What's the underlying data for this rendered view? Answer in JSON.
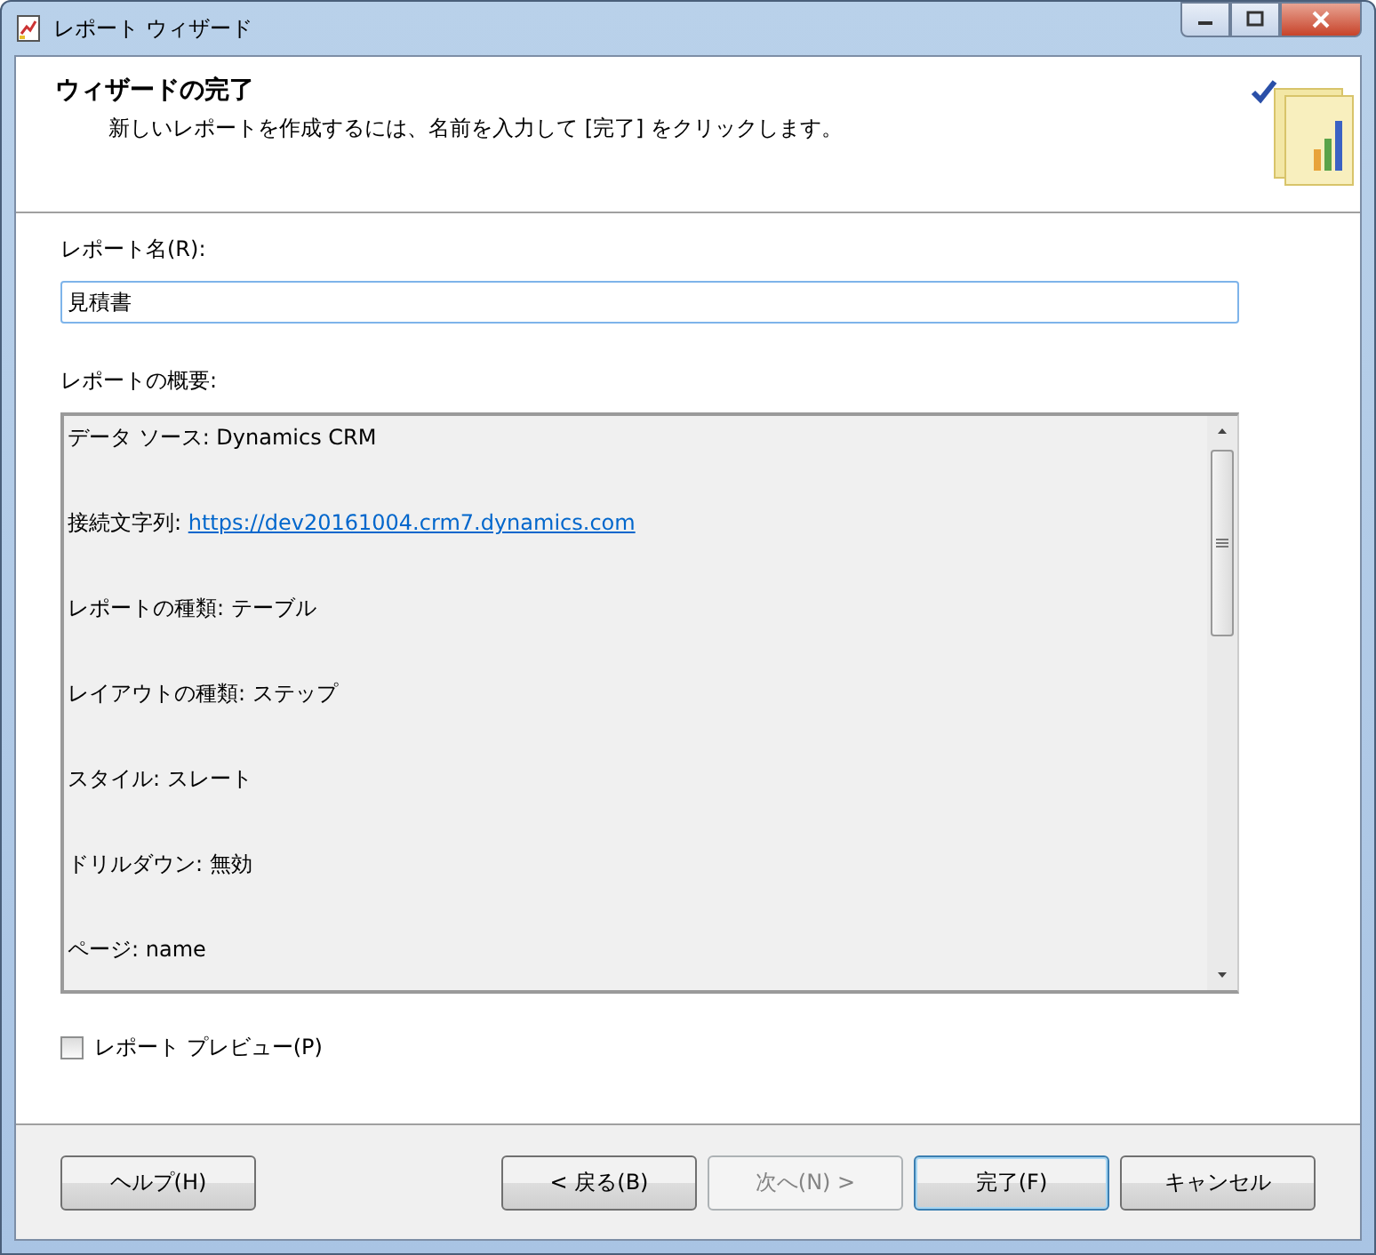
{
  "window": {
    "title": "レポート ウィザード"
  },
  "header": {
    "title": "ウィザードの完了",
    "subtitle": "新しいレポートを作成するには、名前を入力して [完了] をクリックします。"
  },
  "report_name": {
    "label": "レポート名(R):",
    "value": "見積書"
  },
  "summary": {
    "label": "レポートの概要:",
    "lines": [
      {
        "label": "データ ソース: ",
        "value": "Dynamics CRM",
        "kind": "text"
      },
      {
        "label": "接続文字列: ",
        "value": "https://dev20161004.crm7.dynamics.com",
        "kind": "link"
      },
      {
        "label": "レポートの種類: ",
        "value": "テーブル",
        "kind": "text"
      },
      {
        "label": "レイアウトの種類: ",
        "value": "ステップ",
        "kind": "text"
      },
      {
        "label": "スタイル: ",
        "value": "スレート",
        "kind": "text"
      },
      {
        "label": "ドリルダウン: ",
        "value": "無効",
        "kind": "text"
      },
      {
        "label": "ページ: ",
        "value": "name",
        "kind": "text"
      }
    ]
  },
  "preview": {
    "label": "レポート プレビュー(P)",
    "checked": false
  },
  "buttons": [
    {
      "label": "ヘルプ(H)",
      "disabled": false,
      "default": false
    },
    {
      "label": "< 戻る(B)",
      "disabled": false,
      "default": false
    },
    {
      "label": "次へ(N) >",
      "disabled": true,
      "default": false
    },
    {
      "label": "完了(F)",
      "disabled": false,
      "default": true
    },
    {
      "label": "キャンセル",
      "disabled": false,
      "default": false
    }
  ]
}
